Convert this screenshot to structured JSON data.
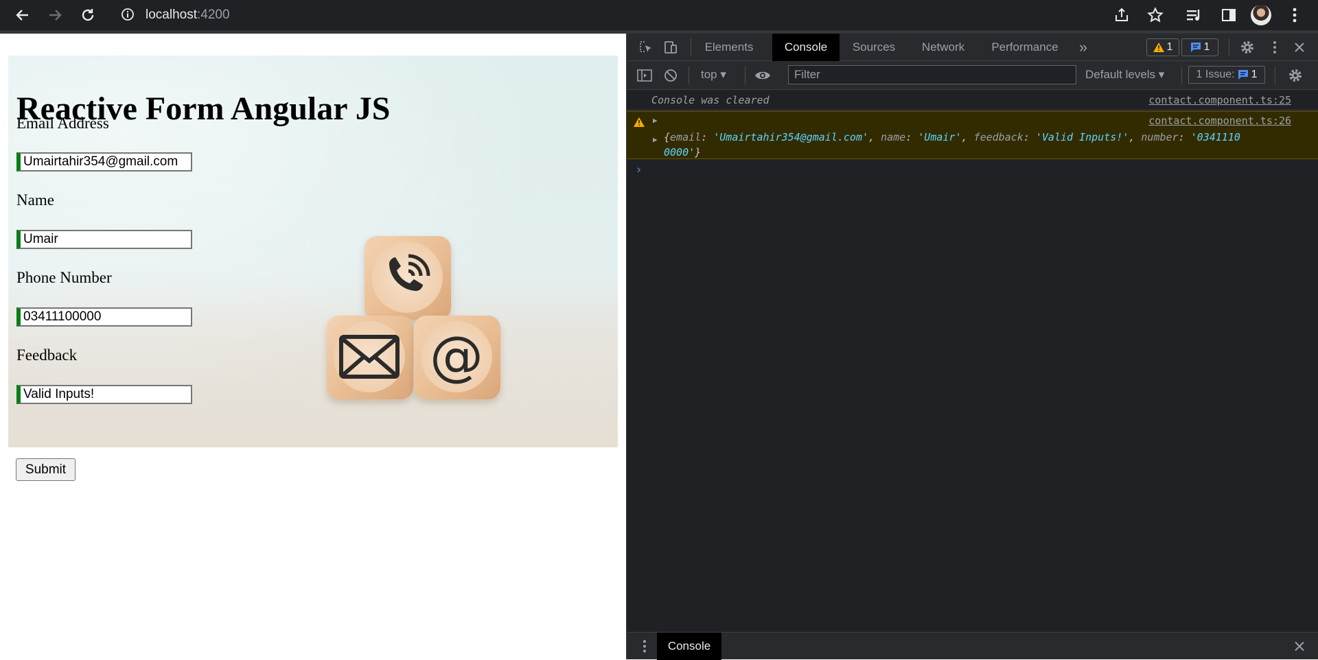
{
  "browser": {
    "url_host": "localhost",
    "url_port": ":4200"
  },
  "form": {
    "title": "Reactive Form Angular JS",
    "email_label": "Email Address",
    "email_value": "Umairtahir354@gmail.com",
    "name_label": "Name",
    "name_value": "Umair",
    "phone_label": "Phone Number",
    "phone_value": "03411100000",
    "feedback_label": "Feedback",
    "feedback_value": "Valid Inputs!",
    "submit_label": "Submit",
    "valid_color": "#0a7d18"
  },
  "devtools": {
    "tabs": [
      "Elements",
      "Console",
      "Sources",
      "Network",
      "Performance"
    ],
    "active_tab": "Console",
    "more_tabs": "»",
    "warnings_count": "1",
    "messages_count": "1",
    "context": "top",
    "filter_placeholder": "Filter",
    "levels": "Default levels",
    "issues_label": "1 Issue:",
    "issues_count": "1",
    "console": {
      "cleared_message": "Console was cleared",
      "cleared_source": "contact.component.ts:25",
      "warn_source": "contact.component.ts:26",
      "log_open": "{",
      "k_email": "email",
      "v_email": "'Umairtahir354@gmail.com'",
      "k_name": "name",
      "v_name": "'Umair'",
      "k_feedback": "feedback",
      "v_feedback": "'Valid Inputs!'",
      "k_number": "number",
      "v_number_line1": "'0341110",
      "v_number_line2": "0000'",
      "log_close": "}",
      "prompt": "›"
    },
    "drawer_tab": "Console"
  }
}
